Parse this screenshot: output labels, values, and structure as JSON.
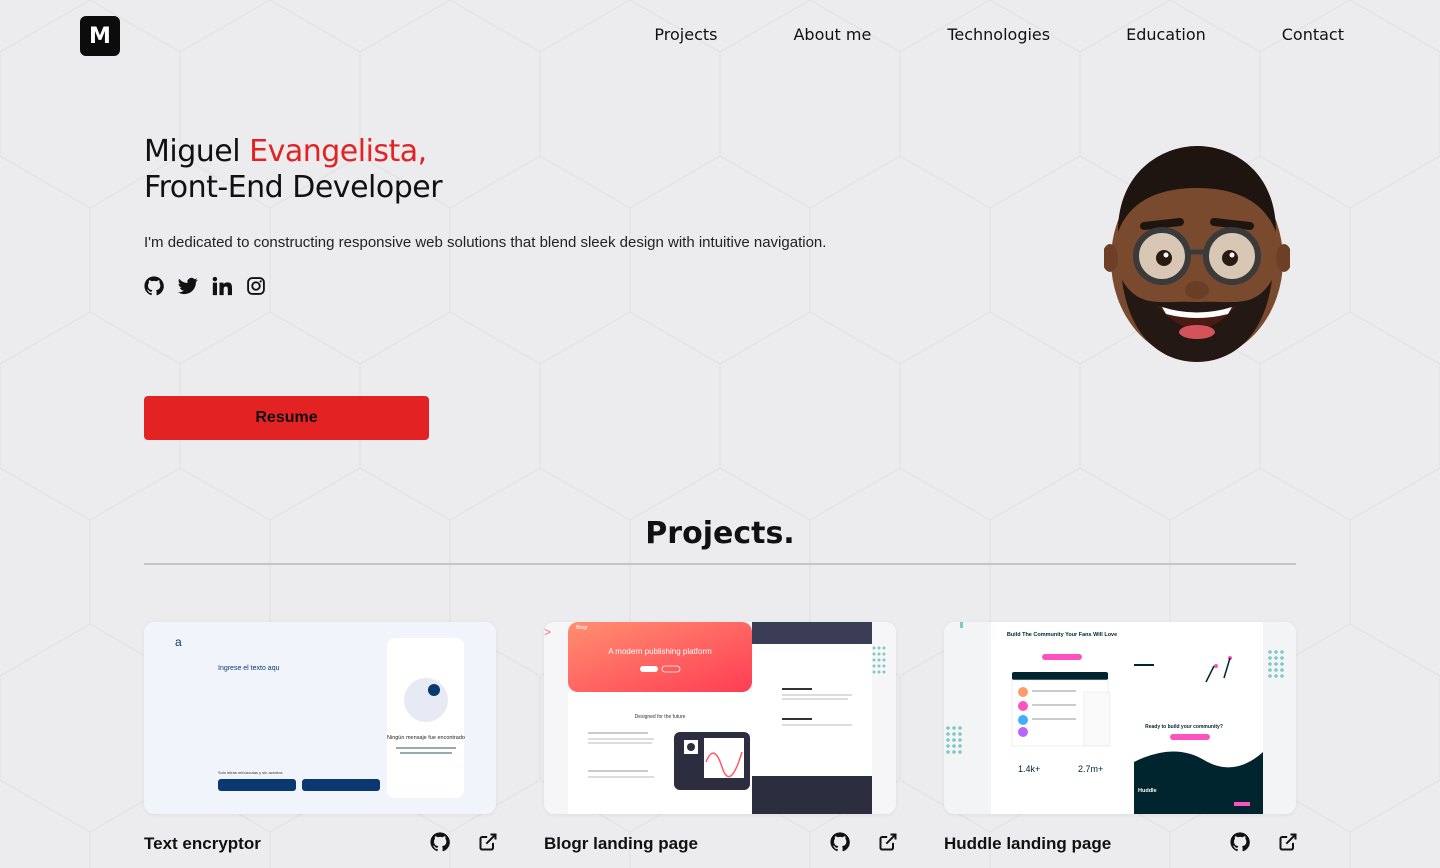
{
  "brand": {
    "logo_letter": "M"
  },
  "nav": {
    "items": [
      "Projects",
      "About me",
      "Technologies",
      "Education",
      "Contact"
    ]
  },
  "hero": {
    "name_first": "Miguel",
    "name_accent": "Evangelista,",
    "role": "Front-End Developer",
    "description": "I'm dedicated to constructing responsive web solutions that blend sleek design with intuitive navigation.",
    "socials": [
      "github-icon",
      "twitter-icon",
      "linkedin-icon",
      "instagram-icon"
    ],
    "resume_label": "Resume"
  },
  "projects": {
    "heading": "Projects.",
    "items": [
      {
        "name": "Text encryptor",
        "preview": {
          "logo_char": "a",
          "input_text": "Ingrese el texto aqu",
          "panel_title": "Ningún mensaje fue encontrado",
          "footer_text": "Solo letras minúsculas y sin acentos"
        }
      },
      {
        "name": "Blogr landing page",
        "preview": {
          "brand": "Blogr",
          "hero_text": "A modern publishing platform",
          "section_text": "Designed for the future"
        }
      },
      {
        "name": "Huddle landing page",
        "preview": {
          "headline": "Build The Community Your Fans Will Love",
          "stat_1": "1.4k+",
          "stat_2": "2.7m+",
          "cta": "Ready to build your community?",
          "brand": "Huddle"
        }
      }
    ]
  },
  "colors": {
    "accent": "#e32224",
    "background": "#ececee",
    "dark": "#0c0c0c"
  }
}
